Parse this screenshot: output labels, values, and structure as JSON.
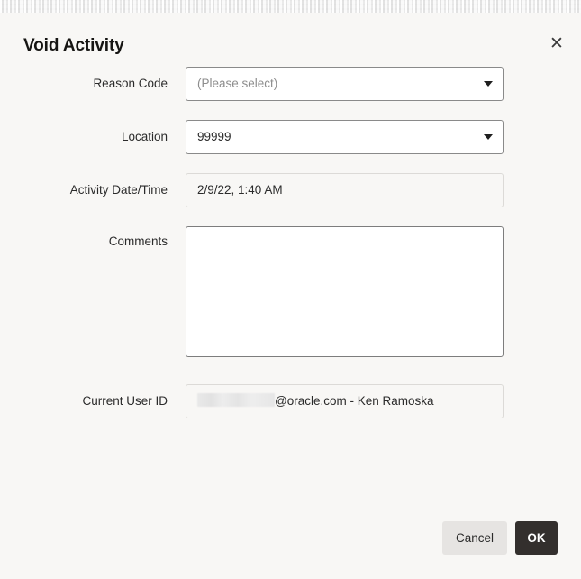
{
  "dialog": {
    "title": "Void Activity",
    "close_icon": "close-icon",
    "close_label": "✕"
  },
  "form": {
    "fields": [
      {
        "label": "Reason Code",
        "type": "select",
        "value": "",
        "placeholder": "(Please select)",
        "arrow_icon": "chevron-down-icon"
      },
      {
        "label": "Location",
        "type": "select",
        "value": "99999",
        "placeholder": "",
        "arrow_icon": "chevron-down-icon"
      },
      {
        "label": "Activity Date/Time",
        "type": "readonly",
        "value": "2/9/22, 1:40 AM"
      },
      {
        "label": "Comments",
        "type": "textarea",
        "value": "",
        "placeholder": ""
      },
      {
        "label": "Current User ID",
        "type": "readonly-redacted",
        "value": "@oracle.com - Ken Ramoska"
      }
    ]
  },
  "footer": {
    "cancel_label": "Cancel",
    "ok_label": "OK"
  },
  "colors": {
    "dialog_background": "#f8f7f5",
    "primary_button": "#332f2d",
    "secondary_button": "#e6e4e2",
    "field_border": "#8a8a8a",
    "readonly_border": "#dcdad7",
    "title_text": "#161513",
    "placeholder_text": "#8d8d8d"
  }
}
